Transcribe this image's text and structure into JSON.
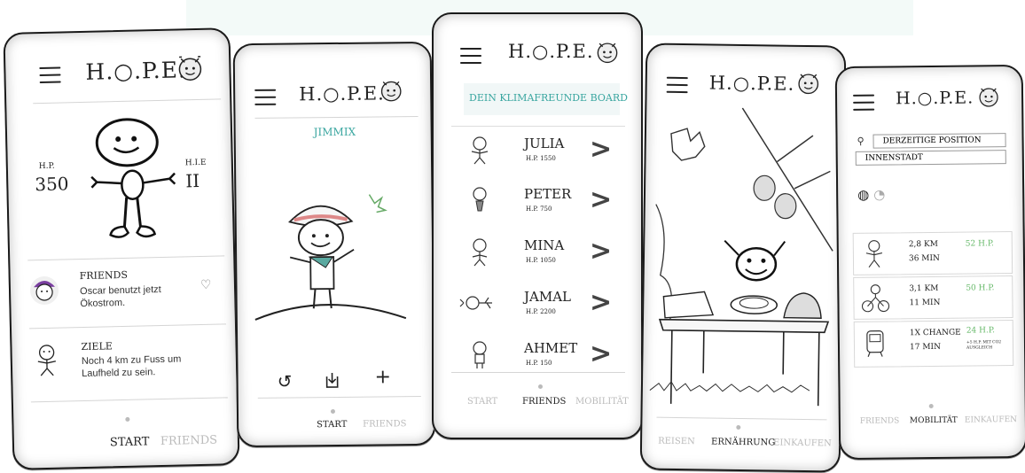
{
  "app": {
    "logo": "H.○.P.E."
  },
  "s1": {
    "hp_label": "H.P.",
    "hp_value": "350",
    "hi_label": "H.I.E",
    "hi_value": "II",
    "friends_title": "FRIENDS",
    "friends_text": "Oscar benutzt jetzt Ökostrom.",
    "ziele_title": "ZIELE",
    "ziele_text": "Noch 4 km zu Fuss um Laufheld zu sein.",
    "tabs": [
      "START",
      "FRIENDS"
    ]
  },
  "s2": {
    "name": "JIMMIX",
    "tabs": [
      "START",
      "FRIENDS"
    ]
  },
  "s3": {
    "board_title": "DEIN KLIMAFREUNDE BOARD",
    "friends": [
      {
        "name": "JULIA",
        "hp": "H.P. 1550"
      },
      {
        "name": "PETER",
        "hp": "H.P. 750"
      },
      {
        "name": "MINA",
        "hp": "H.P. 1050"
      },
      {
        "name": "JAMAL",
        "hp": "H.P. 2200"
      },
      {
        "name": "AHMET",
        "hp": "H.P. 150"
      }
    ],
    "chevron": ">",
    "tabs": [
      "START",
      "FRIENDS",
      "MOBILITÄT"
    ]
  },
  "s4": {
    "tabs": [
      "REISEN",
      "ERNÄHRUNG",
      "EINKAUFEN"
    ]
  },
  "s5": {
    "position_label": "DERZEITIGE POSITION",
    "position_value": "INNENSTADT",
    "trips": [
      {
        "dist": "2,8 KM",
        "time": "36 MIN",
        "hp": "52 H.P.",
        "note": ""
      },
      {
        "dist": "3,1 KM",
        "time": "11 MIN",
        "hp": "50 H.P.",
        "note": ""
      },
      {
        "dist": "1X CHANGE",
        "time": "17 MIN",
        "hp": "24 H.P.",
        "note": "+5 H.P. MIT CO2 AUSGLEICH"
      }
    ],
    "tabs": [
      "FRIENDS",
      "MOBILITÄT",
      "EINKAUFEN"
    ]
  },
  "colors": {
    "teal": "#3aa6a0",
    "green": "#67b96a",
    "ink": "#222222",
    "muted": "#bbbbbb"
  }
}
